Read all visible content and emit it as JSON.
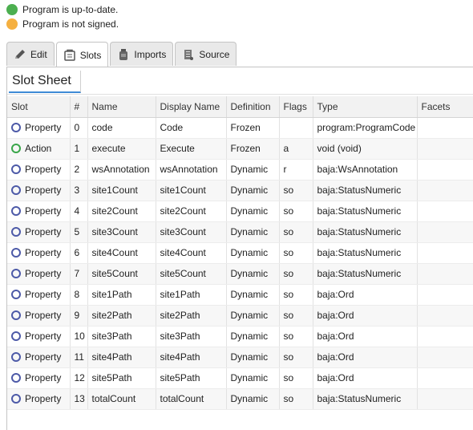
{
  "status": {
    "items": [
      {
        "text": "Program is up-to-date.",
        "color": "#4caf50"
      },
      {
        "text": "Program is not signed.",
        "color": "#f5b041"
      }
    ]
  },
  "tabs": [
    {
      "label": "Edit",
      "icon": "pencil-icon",
      "active": false
    },
    {
      "label": "Slots",
      "icon": "slots-icon",
      "active": true
    },
    {
      "label": "Imports",
      "icon": "jar-icon",
      "active": false
    },
    {
      "label": "Source",
      "icon": "scroll-icon",
      "active": false
    }
  ],
  "sheet": {
    "title": "Slot Sheet"
  },
  "table": {
    "headers": {
      "slot": "Slot",
      "index": "#",
      "name": "Name",
      "display_name": "Display Name",
      "definition": "Definition",
      "flags": "Flags",
      "type": "Type",
      "facets": "Facets"
    },
    "rows": [
      {
        "slot": "Property",
        "index": "0",
        "name": "code",
        "display_name": "Code",
        "definition": "Frozen",
        "flags": "",
        "type": "program:ProgramCode",
        "facets": ""
      },
      {
        "slot": "Action",
        "index": "1",
        "name": "execute",
        "display_name": "Execute",
        "definition": "Frozen",
        "flags": "a",
        "type": "void (void)",
        "facets": ""
      },
      {
        "slot": "Property",
        "index": "2",
        "name": "wsAnnotation",
        "display_name": "wsAnnotation",
        "definition": "Dynamic",
        "flags": "r",
        "type": "baja:WsAnnotation",
        "facets": ""
      },
      {
        "slot": "Property",
        "index": "3",
        "name": "site1Count",
        "display_name": "site1Count",
        "definition": "Dynamic",
        "flags": "so",
        "type": "baja:StatusNumeric",
        "facets": ""
      },
      {
        "slot": "Property",
        "index": "4",
        "name": "site2Count",
        "display_name": "site2Count",
        "definition": "Dynamic",
        "flags": "so",
        "type": "baja:StatusNumeric",
        "facets": ""
      },
      {
        "slot": "Property",
        "index": "5",
        "name": "site3Count",
        "display_name": "site3Count",
        "definition": "Dynamic",
        "flags": "so",
        "type": "baja:StatusNumeric",
        "facets": ""
      },
      {
        "slot": "Property",
        "index": "6",
        "name": "site4Count",
        "display_name": "site4Count",
        "definition": "Dynamic",
        "flags": "so",
        "type": "baja:StatusNumeric",
        "facets": ""
      },
      {
        "slot": "Property",
        "index": "7",
        "name": "site5Count",
        "display_name": "site5Count",
        "definition": "Dynamic",
        "flags": "so",
        "type": "baja:StatusNumeric",
        "facets": ""
      },
      {
        "slot": "Property",
        "index": "8",
        "name": "site1Path",
        "display_name": "site1Path",
        "definition": "Dynamic",
        "flags": "so",
        "type": "baja:Ord",
        "facets": ""
      },
      {
        "slot": "Property",
        "index": "9",
        "name": "site2Path",
        "display_name": "site2Path",
        "definition": "Dynamic",
        "flags": "so",
        "type": "baja:Ord",
        "facets": ""
      },
      {
        "slot": "Property",
        "index": "10",
        "name": "site3Path",
        "display_name": "site3Path",
        "definition": "Dynamic",
        "flags": "so",
        "type": "baja:Ord",
        "facets": ""
      },
      {
        "slot": "Property",
        "index": "11",
        "name": "site4Path",
        "display_name": "site4Path",
        "definition": "Dynamic",
        "flags": "so",
        "type": "baja:Ord",
        "facets": ""
      },
      {
        "slot": "Property",
        "index": "12",
        "name": "site5Path",
        "display_name": "site5Path",
        "definition": "Dynamic",
        "flags": "so",
        "type": "baja:Ord",
        "facets": ""
      },
      {
        "slot": "Property",
        "index": "13",
        "name": "totalCount",
        "display_name": "totalCount",
        "definition": "Dynamic",
        "flags": "so",
        "type": "baja:StatusNumeric",
        "facets": ""
      }
    ]
  }
}
